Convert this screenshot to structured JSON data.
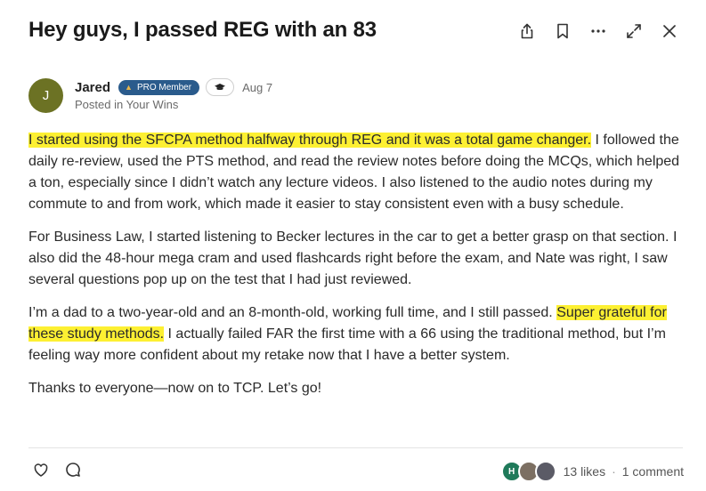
{
  "post": {
    "title": "Hey guys, I passed REG with an 83",
    "toolbar": {
      "icons": [
        "share-icon",
        "bookmark-icon",
        "more-icon",
        "expand-icon",
        "close-icon"
      ]
    },
    "author": {
      "initial": "J",
      "name": "Jared",
      "badge": "PRO Member",
      "date": "Aug 7",
      "posted_in": "Posted in Your Wins",
      "avatar_color": "#6c7224",
      "badge_color": "#2a5b8c"
    },
    "paragraphs": {
      "p1": {
        "highlight": "I started using the SFCPA method halfway through REG and it was a total game changer.",
        "rest": " I followed the daily re-review, used the PTS method, and read the review notes before doing the MCQs, which helped a ton, especially since I didn’t watch any lecture videos. I also listened to the audio notes during my commute to and from work, which made it easier to stay consistent even with a busy schedule."
      },
      "p2": "For Business Law, I started listening to Becker lectures in the car to get a better grasp on that section. I also did the 48-hour mega cram and used flashcards right before the exam, and Nate was right, I saw several questions pop up on the test that I had just reviewed.",
      "p3": {
        "before": "I’m a dad to a two-year-old and an 8-month-old, working full time, and I still passed. ",
        "highlight": "Super grateful for these study methods.",
        "after": " I actually failed FAR the first time with a 66 using the traditional method, but I’m feeling way more confident about my retake now that I have a better system."
      },
      "p4": "Thanks to everyone—now on to TCP. Let’s go!"
    },
    "highlight_color": "#fdf032",
    "footer": {
      "liker_initial": "H",
      "likes": "13 likes",
      "separator": "·",
      "comments": "1 comment"
    }
  }
}
